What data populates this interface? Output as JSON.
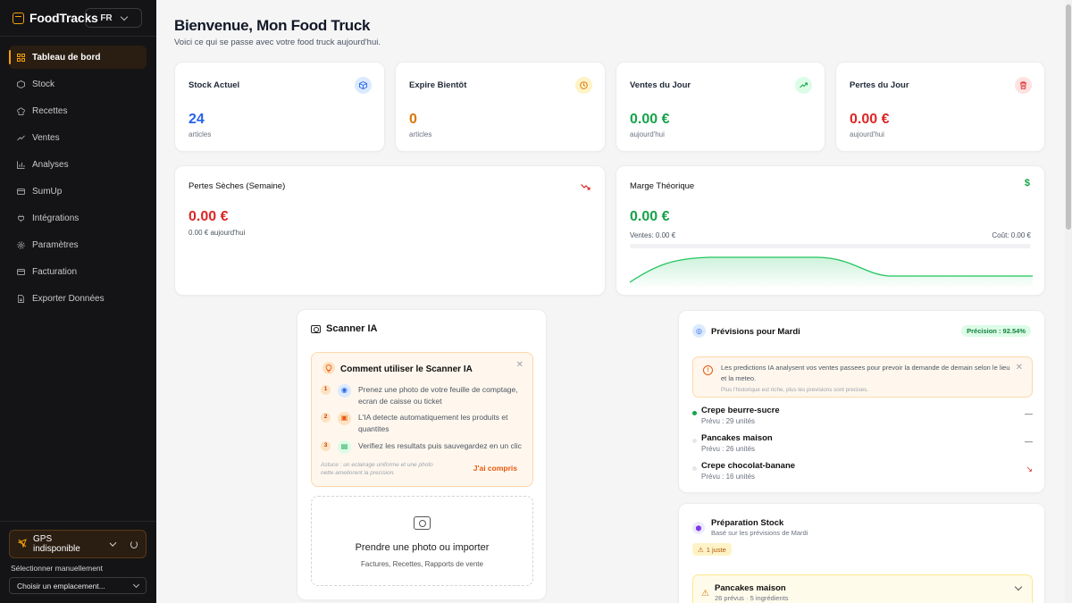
{
  "app": {
    "name": "FoodTracks",
    "language": "FR"
  },
  "sidebar": {
    "items": [
      {
        "label": "Tableau de bord",
        "icon": "dashboard-icon",
        "active": true
      },
      {
        "label": "Stock",
        "icon": "box-icon"
      },
      {
        "label": "Recettes",
        "icon": "chef-hat-icon"
      },
      {
        "label": "Ventes",
        "icon": "trending-up-icon"
      },
      {
        "label": "Analyses",
        "icon": "bar-chart-icon"
      },
      {
        "label": "SumUp",
        "icon": "card-icon"
      },
      {
        "label": "Intégrations",
        "icon": "plug-icon"
      },
      {
        "label": "Paramètres",
        "icon": "gear-icon"
      },
      {
        "label": "Facturation",
        "icon": "receipt-icon"
      },
      {
        "label": "Exporter Données",
        "icon": "file-export-icon"
      }
    ],
    "gps": {
      "label": "GPS indisponible"
    },
    "manual_label": "Sélectionner manuellement",
    "location_select": "Choisir un emplacement..."
  },
  "header": {
    "title": "Bienvenue, Mon Food Truck",
    "subtitle": "Voici ce qui se passe avec votre food truck aujourd'hui."
  },
  "stats": [
    {
      "title": "Stock Actuel",
      "value": "24",
      "unit": "articles",
      "color": "#2563eb",
      "icon": "box-icon"
    },
    {
      "title": "Expire Bientôt",
      "value": "0",
      "unit": "articles",
      "color": "#d97706",
      "icon": "clock-icon"
    },
    {
      "title": "Ventes du Jour",
      "value": "0.00 €",
      "unit": "aujourd'hui",
      "color": "#16a34a",
      "icon": "trending-up-icon"
    },
    {
      "title": "Pertes du Jour",
      "value": "0.00 €",
      "unit": "aujourd'hui",
      "color": "#dc2626",
      "icon": "trash-icon"
    }
  ],
  "losses_week": {
    "title": "Pertes Sèches (Semaine)",
    "value": "0.00 €",
    "sub": "0.00 € aujourd'hui"
  },
  "margin": {
    "title": "Marge Théorique",
    "value": "0.00 €",
    "sales": "Ventes: 0.00 €",
    "cost": "Coût: 0.00 €"
  },
  "scanner": {
    "title": "Scanner IA",
    "howto_title": "Comment utiliser le Scanner IA",
    "steps": [
      {
        "num": "1",
        "text": "Prenez une photo de votre feuille de comptage, ecran de caisse ou ticket"
      },
      {
        "num": "2",
        "text": "L'IA detecte automatiquement les produits et quantites"
      },
      {
        "num": "3",
        "text": "Verifiez les resultats puis sauvegardez en un clic"
      }
    ],
    "tip": "Astuce : un eclairage uniforme et une photo nette ameliorent la precision.",
    "got_it": "J'ai compris",
    "upload_title": "Prendre une photo ou importer",
    "upload_sub": "Factures, Recettes, Rapports de vente"
  },
  "predictions": {
    "title": "Prévisions pour Mardi",
    "precision": "Précision : 92.54%",
    "info": "Les predictions IA analysent vos ventes passees pour prevoir la demande de demain selon le lieu et la meteo.",
    "info_sub": "Plus l'historique est riche, plus les previsions sont precises.",
    "items": [
      {
        "name": "Crepe beurre-sucre",
        "sub": "Prévu : 29 unités",
        "trend": "—",
        "trend_color": "#374151",
        "active": true
      },
      {
        "name": "Pancakes maison",
        "sub": "Prévu : 26 unités",
        "trend": "—",
        "trend_color": "#374151",
        "active": false
      },
      {
        "name": "Crepe chocolat-banane",
        "sub": "Prévu : 16 unités",
        "trend": "↘",
        "trend_color": "#dc2626",
        "active": false
      }
    ]
  },
  "prep": {
    "title": "Préparation Stock",
    "sub": "Basé sur les prévisions de Mardi",
    "badge": "1 juste",
    "item": {
      "name": "Pancakes maison",
      "sub": "26 prévus · 5 ingrédients"
    }
  }
}
